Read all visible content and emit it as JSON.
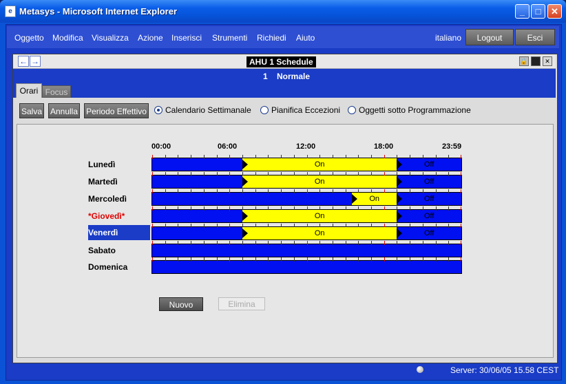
{
  "window": {
    "title": "Metasys - Microsoft Internet Explorer",
    "minimize": "_",
    "maximize": "□",
    "close": "✕"
  },
  "menu": {
    "items": [
      "Oggetto",
      "Modifica",
      "Visualizza",
      "Azione",
      "Inserisci",
      "Strumenti",
      "Richiedi",
      "Aiuto"
    ],
    "language": "italiano",
    "logout": "Logout",
    "exit": "Esci"
  },
  "panel": {
    "title": "AHU 1 Schedule",
    "subtitle": "1    Normale",
    "tabs": [
      "Orari",
      "Focus"
    ],
    "active_tab": "Orari"
  },
  "toolbar": {
    "save": "Salva",
    "cancel": "Annulla",
    "effective_period": "Periodo Effettivo",
    "radio_weekly": "Calendario Settimanale",
    "radio_exceptions": "Pianifica Eccezioni",
    "radio_objects": "Oggetti sotto Programmazione",
    "selected_radio": "weekly"
  },
  "schedule": {
    "time_labels": [
      "00:00",
      "06:00",
      "12:00",
      "18:00",
      "23:59"
    ],
    "days": [
      {
        "name": "Lunedì",
        "on_label": "On",
        "off_label": "Off",
        "on_start": "07:00",
        "on_end": "19:00"
      },
      {
        "name": "Martedì",
        "on_label": "On",
        "off_label": "Off",
        "on_start": "07:00",
        "on_end": "19:00"
      },
      {
        "name": "Mercoledì",
        "on_label": "On",
        "off_label": "Off",
        "on_start": "15:30",
        "on_end": "19:00"
      },
      {
        "name": "*Giovedì*",
        "on_label": "On",
        "off_label": "Off",
        "on_start": "07:00",
        "on_end": "19:00",
        "modified": true
      },
      {
        "name": "Venerdì",
        "on_label": "On",
        "off_label": "Off",
        "on_start": "07:00",
        "on_end": "19:00",
        "selected": true
      },
      {
        "name": "Sabato"
      },
      {
        "name": "Domenica"
      }
    ]
  },
  "actions": {
    "new": "Nuovo",
    "delete": "Elimina"
  },
  "status": {
    "server": "Server: 30/06/05 15.58 CEST"
  },
  "colors": {
    "schedule_off": "#0010f0",
    "schedule_on": "#ffff00",
    "frame": "#1a3cc6",
    "modified_day": "#e00000"
  }
}
